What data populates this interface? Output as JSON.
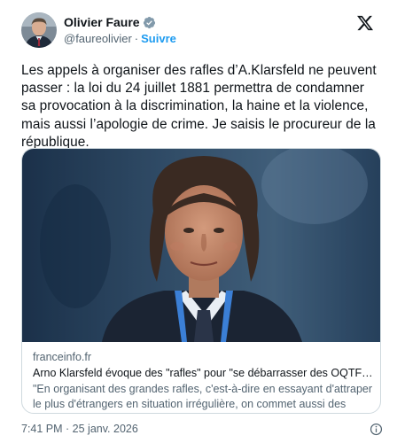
{
  "author": {
    "name": "Olivier Faure",
    "handle": "@faureolivier",
    "separator": "·",
    "follow_label": "Suivre"
  },
  "tweet": {
    "text": "Les appels à organiser des rafles d’A.Klarsfeld ne peuvent passer : la loi du 24 juillet 1881 permettra de condamner sa provocation à la discrimination, la haine et la violence, mais aussi l’apologie de crime. Je saisis le procureur de la république."
  },
  "link_card": {
    "domain": "franceinfo.fr",
    "title": "Arno Klarsfeld évoque des \"rafles\" pour \"se débarrasser des OQTF\" en Fr...",
    "description": "\"En organisant des grandes rafles, c'est-à-dire en essayant d'attraper le plus d'étrangers en situation irrégulière, on commet aussi des injustices\"..."
  },
  "footer": {
    "timestamp": "7:41 PM · 25 janv. 2026"
  },
  "icons": {
    "verified": "verified-badge-icon",
    "platform": "x-logo-icon",
    "info": "info-icon"
  },
  "colors": {
    "accent": "#1d9bf0",
    "text": "#0f1419",
    "secondary_text": "#536471",
    "border": "#cfd9de"
  }
}
